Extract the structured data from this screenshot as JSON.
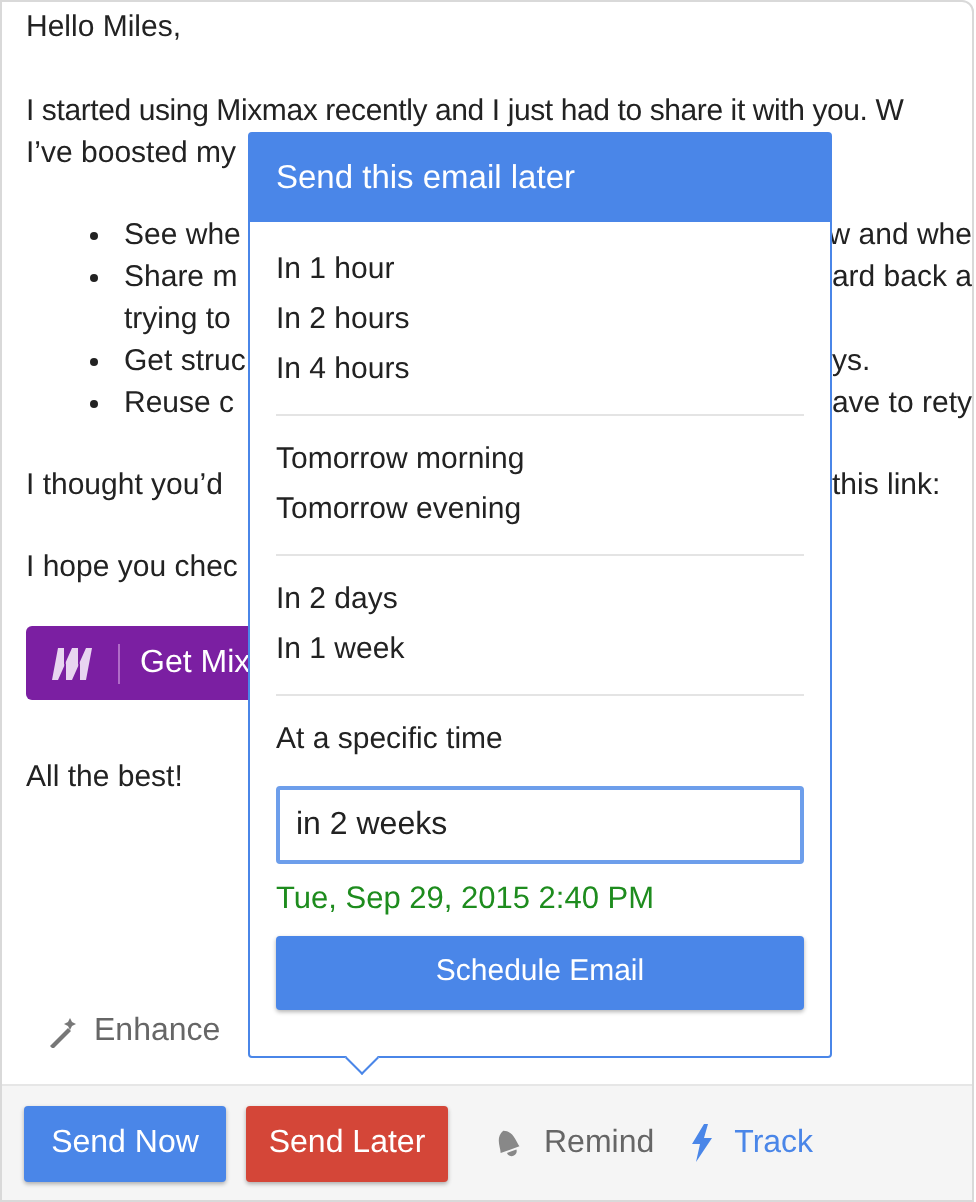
{
  "email": {
    "blocks": [
      {
        "kind": "text",
        "lines": [
          {
            "left": "Hello Miles,"
          }
        ]
      },
      {
        "kind": "text",
        "lines": [
          {
            "left": "I started using Mixmax recently and I just had to share it with you. W",
            "kind": "wide"
          },
          {
            "left": "I’ve boosted my"
          }
        ]
      },
      {
        "kind": "list",
        "lines": [
          {
            "left": "See whe",
            "right": "w and whe",
            "kind": "bullet"
          },
          {
            "left": "Share m",
            "right": "ard back a",
            "kind": "bullet"
          },
          {
            "left": "trying to",
            "kind": "continuation"
          },
          {
            "left": "Get struc",
            "right": "ys.",
            "kind": "bullet"
          },
          {
            "left": "Reuse c",
            "right": "ave to rety",
            "kind": "bullet"
          }
        ]
      },
      {
        "kind": "text",
        "lines": [
          {
            "left": "I thought you’d",
            "right": "this link:"
          }
        ]
      },
      {
        "kind": "text",
        "lines": [
          {
            "left": "I hope you chec"
          }
        ]
      },
      {
        "kind": "cta",
        "label": "Get Mix"
      },
      {
        "kind": "text",
        "lines": [
          {
            "left": "All the best!"
          }
        ]
      }
    ],
    "enhance": "Enhance"
  },
  "popover": {
    "title": "Send this email later",
    "groups": [
      [
        "In 1 hour",
        "In 2 hours",
        "In 4 hours"
      ],
      [
        "Tomorrow morning",
        "Tomorrow evening"
      ],
      [
        "In 2 days",
        "In 1 week"
      ]
    ],
    "specific_label": "At a specific time",
    "input_value": "in 2 weeks",
    "parsed_time": "Tue, Sep 29, 2015 2:40 PM",
    "button": "Schedule Email"
  },
  "toolbar": [
    {
      "kind": "primary",
      "label": "Send Now"
    },
    {
      "kind": "danger",
      "label": "Send Later"
    },
    {
      "kind": "remind",
      "label": "Remind"
    },
    {
      "kind": "track",
      "label": "Track"
    }
  ]
}
